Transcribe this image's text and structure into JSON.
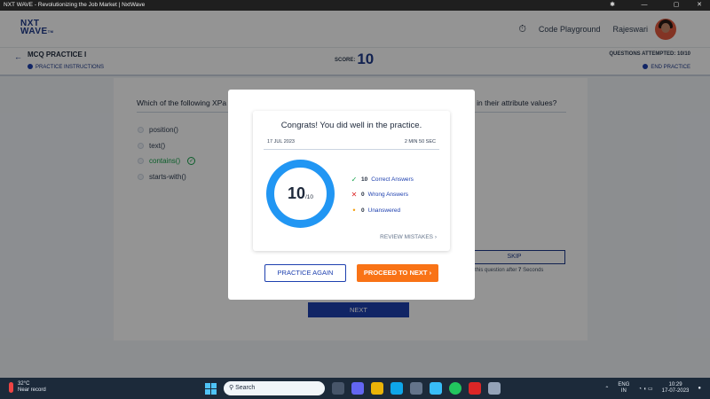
{
  "browser": {
    "title": "NXT WAVE - Revolutionizing the Job Market | NxtWave"
  },
  "header": {
    "logo_line1": "NXT",
    "logo_line2": "WAVE",
    "logo_suffix": "TM",
    "code_playground": "Code Playground",
    "user_name": "Rajeswari"
  },
  "subheader": {
    "title": "MCQ PRACTICE I",
    "instructions": "PRACTICE INSTRUCTIONS",
    "score_label": "SCORE:",
    "score_value": "10",
    "attempted": "QUESTIONS ATTEMPTED: 10/10",
    "end_practice": "END PRACTICE"
  },
  "question": {
    "text_start": "Which of the following XPa",
    "text_end": "g in their attribute values?",
    "options": [
      {
        "label": "position()"
      },
      {
        "label": "text()"
      },
      {
        "label": "contains()"
      },
      {
        "label": "starts-with()"
      }
    ],
    "skip": "SKIP",
    "skip_note_prefix": "p this question after",
    "skip_note_num": "7",
    "skip_note_suffix": "Seconds",
    "next": "NEXT"
  },
  "modal": {
    "congrats": "Congrats! You did well in the practice.",
    "date": "17 JUL 2023",
    "duration": "2 MIN 50 SEC",
    "score": "10",
    "total": "/10",
    "stats": [
      {
        "count": "10",
        "label": "Correct Answers",
        "icon": "check-icon"
      },
      {
        "count": "0",
        "label": "Wrong Answers",
        "icon": "cross-icon"
      },
      {
        "count": "0",
        "label": "Unanswered",
        "icon": "dot-icon"
      }
    ],
    "review": "REVIEW MISTAKES",
    "practice_again": "PRACTICE AGAIN",
    "proceed": "PROCEED TO NEXT"
  },
  "taskbar": {
    "temp": "32°C",
    "weather_note": "Near record",
    "search": "Search",
    "lang1": "ENG",
    "lang2": "IN",
    "time": "10:29",
    "date": "17-07-2023"
  },
  "colors": {
    "brand": "#1e3a8a",
    "ring": "#2196f3",
    "proceed": "#f97316",
    "correct": "#16a34a"
  }
}
